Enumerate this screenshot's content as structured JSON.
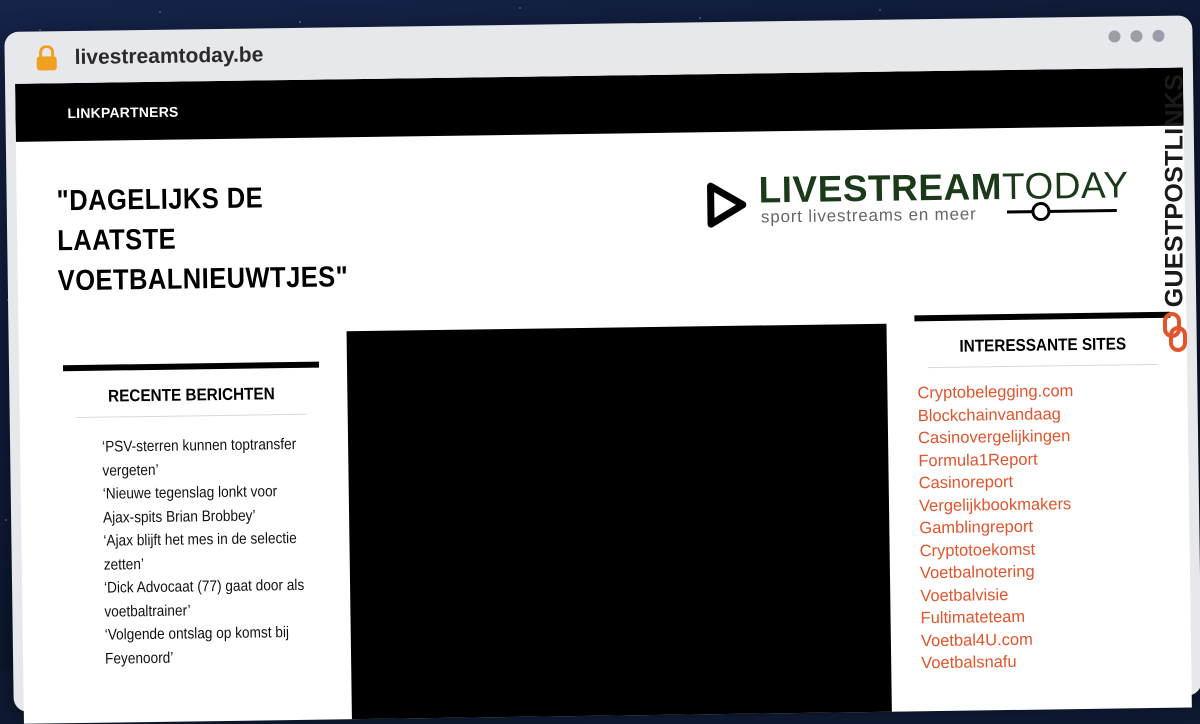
{
  "browser": {
    "url": "livestreamtoday.be"
  },
  "nav": {
    "items": [
      "LINKPARTNERS"
    ]
  },
  "header": {
    "tagline": "\"DAGELIJKS DE LAATSTE VOETBALNIEUWTJES\"",
    "logo_main_bold": "LIVESTREAM",
    "logo_main_light": "TODAY",
    "logo_sub": "sport livestreams en meer"
  },
  "recent": {
    "title": "RECENTE BERICHTEN",
    "posts": [
      "‘PSV-sterren kunnen toptransfer vergeten’",
      "‘Nieuwe tegenslag lonkt voor Ajax-spits Brian Brobbey’",
      "‘Ajax blijft het mes in de selectie zetten’",
      "‘Dick Advocaat (77) gaat door als voetbaltrainer’",
      "‘Volgende ontslag op komst bij Feyenoord’"
    ]
  },
  "interesting": {
    "title": "INTERESSANTE SITES",
    "sites": [
      "Cryptobelegging.com",
      "Blockchainvandaag",
      "Casinovergelijkingen",
      "Formula1Report",
      "Casinoreport",
      "Vergelijkbookmakers",
      "Gamblingreport",
      "Cryptotoekomst",
      "Voetbalnotering",
      "Voetbalvisie",
      "Fultimateteam",
      "Voetbal4U.com",
      "Voetbalsnafu"
    ]
  },
  "badge": {
    "text": "GUESTPOSTLINKS"
  },
  "colors": {
    "accent": "#e0552b",
    "lock": "#f0a020",
    "logo_green": "#1a3a1a"
  },
  "icons": {
    "lock": "lock-icon",
    "logo": "play-triangle-icon",
    "badge": "chain-link-icon"
  }
}
